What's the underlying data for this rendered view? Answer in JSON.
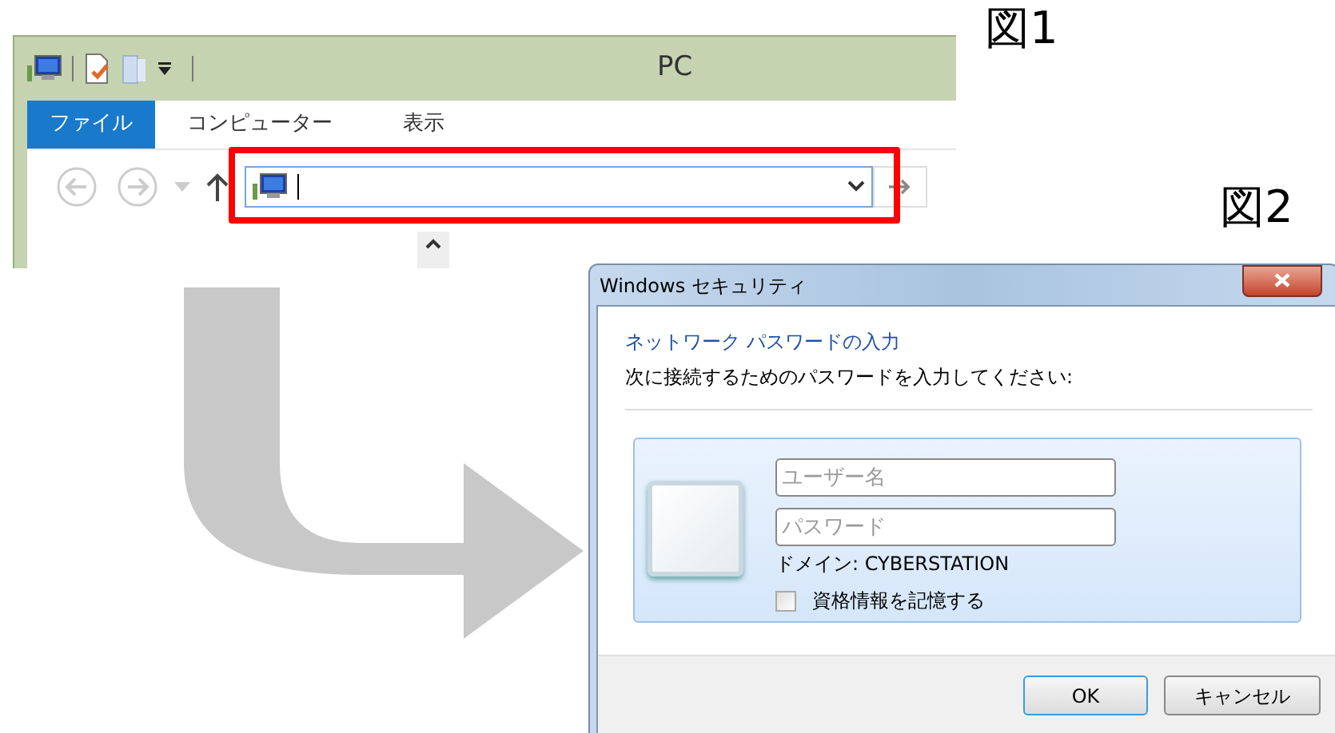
{
  "figure_labels": [
    "図1",
    "図2"
  ],
  "explorer": {
    "title": "PC",
    "ribbon_tabs": [
      {
        "label": "ファイル",
        "selected": true
      },
      {
        "label": "コンピューター",
        "selected": false
      },
      {
        "label": "表示",
        "selected": false
      }
    ],
    "address_highlighted": true
  },
  "dialog": {
    "title": "Windows セキュリティ",
    "heading": "ネットワーク パスワードの入力",
    "instruction": "次に接続するためのパスワードを入力してください:",
    "fields": [
      {
        "placeholder": "ユーザー名"
      },
      {
        "placeholder": "パスワード"
      }
    ],
    "domain": "ドメイン: CYBERSTATION",
    "remember": {
      "label": "資格情報を記憶する",
      "checked": false
    },
    "buttons": [
      "OK",
      "キャンセル"
    ]
  }
}
